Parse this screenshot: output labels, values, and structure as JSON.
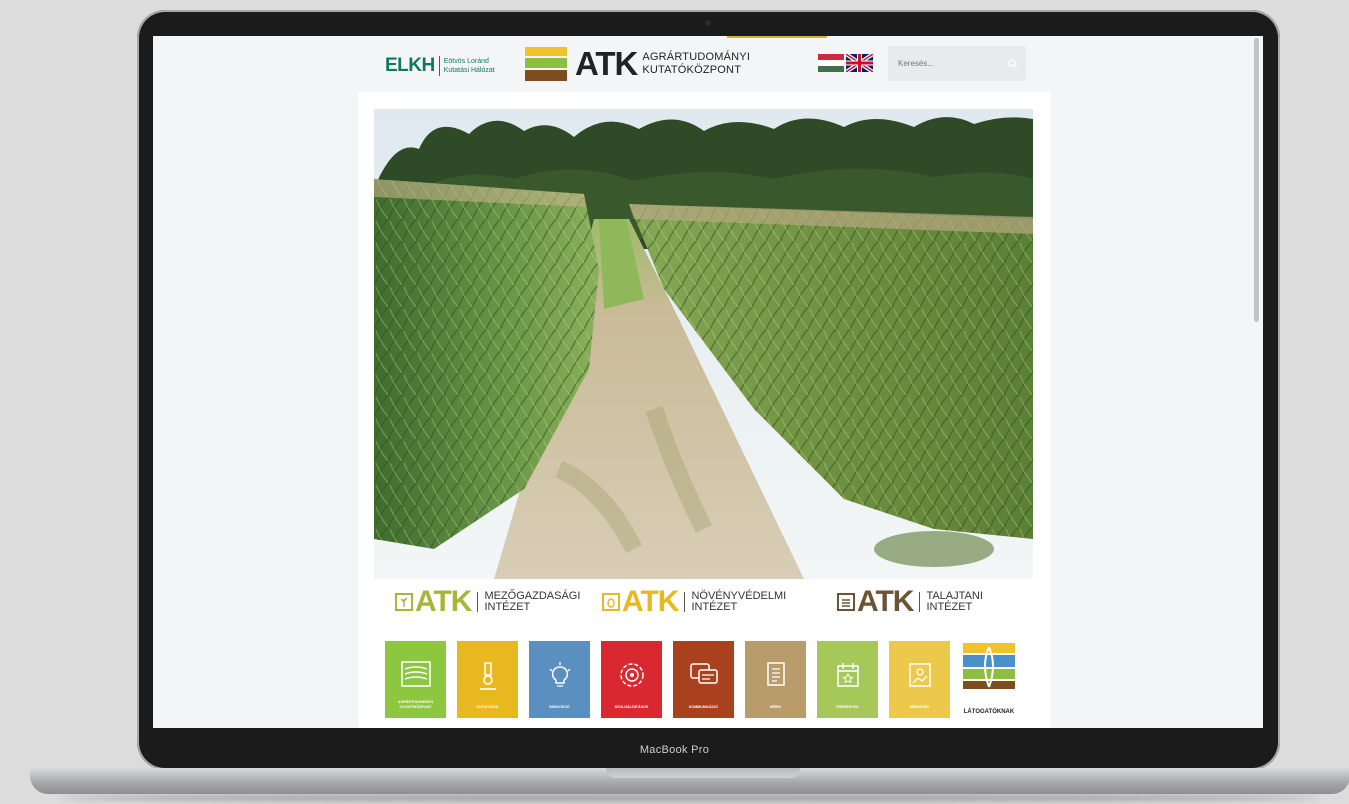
{
  "device": {
    "label": "MacBook Pro"
  },
  "header": {
    "elkh": {
      "mark": "ELKH",
      "line1": "Eötvös Loránd",
      "line2": "Kutatási Hálózat"
    },
    "atk": {
      "mark": "ATK",
      "line1": "AGRÁRTUDOMÁNYI",
      "line2": "KUTATÓKÖZPONT"
    },
    "languages": [
      {
        "code": "hu",
        "icon": "hungarian-flag-icon"
      },
      {
        "code": "en",
        "icon": "uk-flag-icon"
      }
    ],
    "search": {
      "placeholder": "Keresés..."
    }
  },
  "institutes": [
    {
      "mark": "ATK",
      "line1": "MEZŐGAZDASÁGI",
      "line2": "INTÉZET",
      "color": "#a8b53a",
      "icon": "plant-icon"
    },
    {
      "mark": "ATK",
      "line1": "NÖVÉNYVÉDELMI",
      "line2": "INTÉZET",
      "color": "#e8b820",
      "icon": "shield-bug-icon"
    },
    {
      "mark": "ATK",
      "line1": "TALAJTANI",
      "line2": "INTÉZET",
      "color": "#6b5436",
      "icon": "soil-layers-icon"
    }
  ],
  "tiles": [
    {
      "label": "AGRÁRTUDOMÁNYI KUTATÓKÖZPONT",
      "color": "#8dc63f",
      "icon": "layers-icon"
    },
    {
      "label": "KUTATÁSOK",
      "color": "#e8b820",
      "icon": "microscope-icon"
    },
    {
      "label": "INNOVÁCIÓ",
      "color": "#5b8fc0",
      "icon": "lightbulb-icon"
    },
    {
      "label": "SZOLGÁLTATÁSOK",
      "color": "#d9282f",
      "icon": "service-circle-icon"
    },
    {
      "label": "KOMMUNIKÁCIÓ",
      "color": "#a9401e",
      "icon": "chat-icon"
    },
    {
      "label": "HÍREK",
      "color": "#b89c6c",
      "icon": "document-icon"
    },
    {
      "label": "ESEMÉNYEK",
      "color": "#a6c858",
      "icon": "calendar-icon"
    },
    {
      "label": "MÉDIATÁR",
      "color": "#ecc94b",
      "icon": "media-icon"
    }
  ],
  "visitors": {
    "label": "LÁTOGATÓKNAK",
    "icon": "visitor-landscape-icon"
  }
}
